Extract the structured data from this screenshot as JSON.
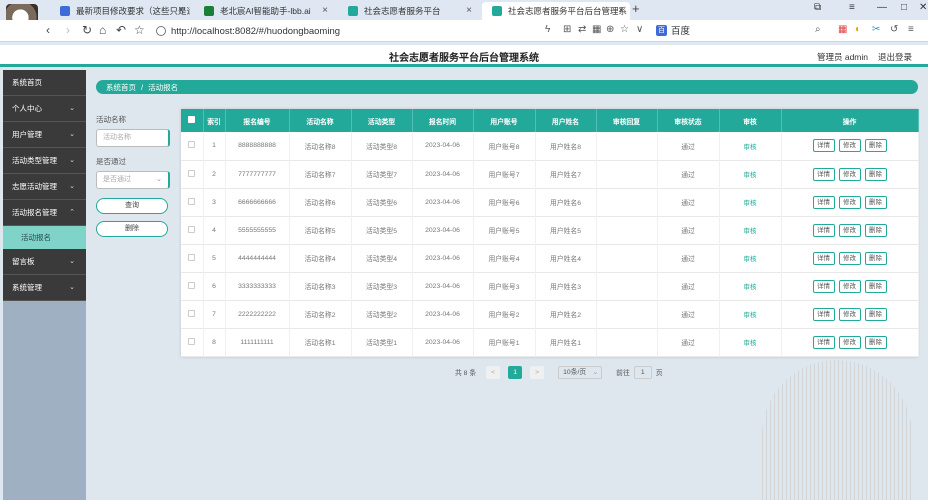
{
  "browser": {
    "tabs": [
      {
        "title": "最新项目修改要求（这些只是适",
        "color": "#3f6bd8",
        "active": false
      },
      {
        "title": "老北宸AI智能助手-lbb.ai",
        "color": "#1a7f37",
        "active": false
      },
      {
        "title": "社会志愿者服务平台",
        "color": "#22a99a",
        "active": false
      },
      {
        "title": "社会志愿者服务平台后台管理系",
        "color": "#22a99a",
        "active": true
      }
    ],
    "url": "http://localhost:8082/#/huodongbaoming",
    "search_engine": "百度"
  },
  "header": {
    "title": "社会志愿者服务平台后台管理系统",
    "user_label": "管理员 admin",
    "logout_label": "退出登录"
  },
  "sidebar": {
    "items": [
      {
        "label": "系统首页",
        "has_chevron": false
      },
      {
        "label": "个人中心",
        "has_chevron": true
      },
      {
        "label": "用户管理",
        "has_chevron": true
      },
      {
        "label": "活动类型管理",
        "has_chevron": true
      },
      {
        "label": "志愿活动管理",
        "has_chevron": true
      },
      {
        "label": "活动报名管理",
        "has_chevron": true,
        "expanded": true
      },
      {
        "label": "留言板",
        "has_chevron": true
      },
      {
        "label": "系统管理",
        "has_chevron": true
      }
    ],
    "active_sub": "活动报名"
  },
  "breadcrumb": {
    "home": "系统首页",
    "separator": "/",
    "current": "活动报名"
  },
  "search": {
    "name_label": "活动名称",
    "name_placeholder": "活动名称",
    "pass_label": "是否通过",
    "pass_placeholder": "是否通过",
    "query_button": "查询",
    "delete_button": "删除"
  },
  "table": {
    "headers": [
      "索引",
      "报名编号",
      "活动名称",
      "活动类型",
      "报名时间",
      "用户账号",
      "用户姓名",
      "审核回复",
      "审核状态",
      "审核",
      "操作"
    ],
    "rows": [
      {
        "index": "1",
        "code": "8888888888",
        "name": "活动名称8",
        "type": "活动类型8",
        "time": "2023-04-06",
        "account": "用户账号8",
        "user": "用户姓名8",
        "reply": "",
        "status": "通过"
      },
      {
        "index": "2",
        "code": "7777777777",
        "name": "活动名称7",
        "type": "活动类型7",
        "time": "2023-04-06",
        "account": "用户账号7",
        "user": "用户姓名7",
        "reply": "",
        "status": "通过"
      },
      {
        "index": "3",
        "code": "6666666666",
        "name": "活动名称6",
        "type": "活动类型6",
        "time": "2023-04-06",
        "account": "用户账号6",
        "user": "用户姓名6",
        "reply": "",
        "status": "通过"
      },
      {
        "index": "4",
        "code": "5555555555",
        "name": "活动名称5",
        "type": "活动类型5",
        "time": "2023-04-06",
        "account": "用户账号5",
        "user": "用户姓名5",
        "reply": "",
        "status": "通过"
      },
      {
        "index": "5",
        "code": "4444444444",
        "name": "活动名称4",
        "type": "活动类型4",
        "time": "2023-04-06",
        "account": "用户账号4",
        "user": "用户姓名4",
        "reply": "",
        "status": "通过"
      },
      {
        "index": "6",
        "code": "3333333333",
        "name": "活动名称3",
        "type": "活动类型3",
        "time": "2023-04-06",
        "account": "用户账号3",
        "user": "用户姓名3",
        "reply": "",
        "status": "通过"
      },
      {
        "index": "7",
        "code": "2222222222",
        "name": "活动名称2",
        "type": "活动类型2",
        "time": "2023-04-06",
        "account": "用户账号2",
        "user": "用户姓名2",
        "reply": "",
        "status": "通过"
      },
      {
        "index": "8",
        "code": "1111111111",
        "name": "活动名称1",
        "type": "活动类型1",
        "time": "2023-04-06",
        "account": "用户账号1",
        "user": "用户姓名1",
        "reply": "",
        "status": "通过"
      }
    ],
    "audit_link": "审核",
    "btn_detail": "详情",
    "btn_edit": "修改",
    "btn_delete": "删除"
  },
  "pager": {
    "total_label": "共 8 条",
    "prev": "<",
    "current_page": "1",
    "next": ">",
    "page_size": "10条/页",
    "goto_label": "前往",
    "goto_value": "1",
    "page_suffix": "页"
  },
  "colors": {
    "accent": "#22a99a",
    "sidebar_bg": "#3a3a3a",
    "sub_active": "#7fd3c8"
  }
}
